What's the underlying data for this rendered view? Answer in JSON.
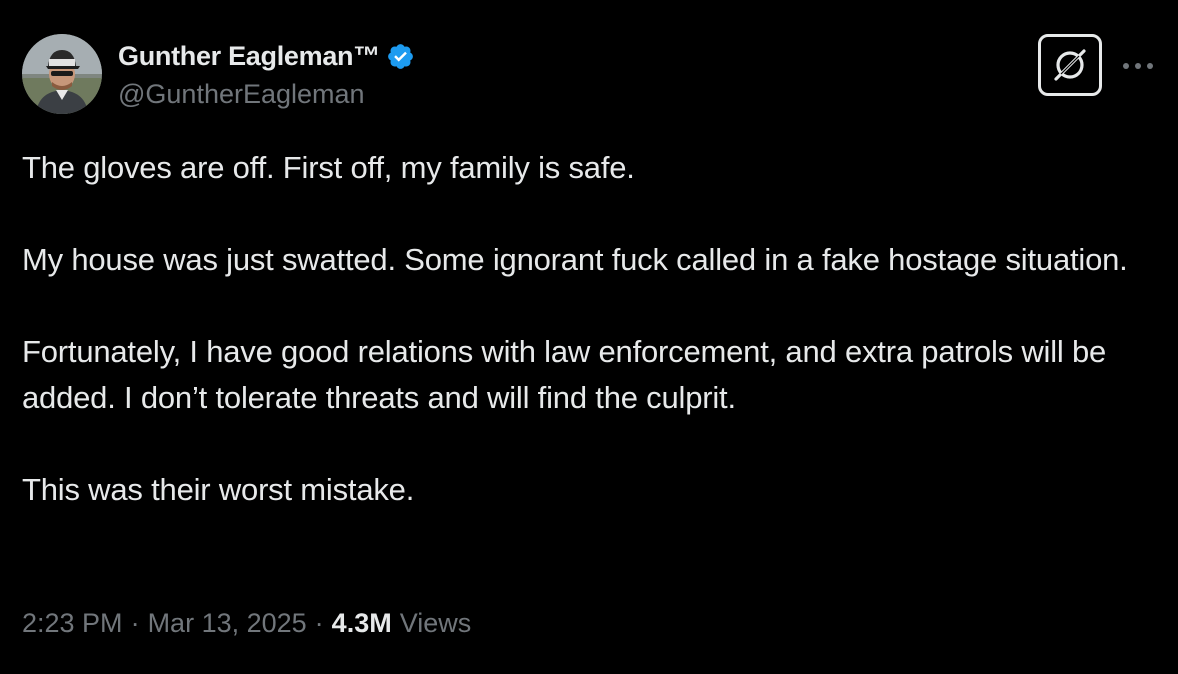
{
  "author": {
    "display_name": "Gunther Eagleman™",
    "handle": "@GuntherEagleman",
    "verified": true,
    "verified_color": "#1d9bf0"
  },
  "tweet": {
    "paragraphs": [
      "The gloves are off. First off, my family is safe.",
      "My house was just swatted. Some ignorant fuck called in a fake hostage situation.",
      "Fortunately, I have good relations with law enforcement, and extra patrols will be added. I don’t tolerate threats and will find the culprit.",
      "This was their worst mistake."
    ]
  },
  "meta": {
    "time": "2:23 PM",
    "separator": "·",
    "date": "Mar 13, 2025",
    "views_count": "4.3M",
    "views_label": "Views"
  },
  "icons": {
    "verified": "verified-badge-icon",
    "grok": "grok-icon",
    "more": "more-dots-icon"
  },
  "colors": {
    "background": "#000000",
    "text_primary": "#e7e9ea",
    "text_secondary": "#71767b",
    "accent": "#1d9bf0"
  }
}
